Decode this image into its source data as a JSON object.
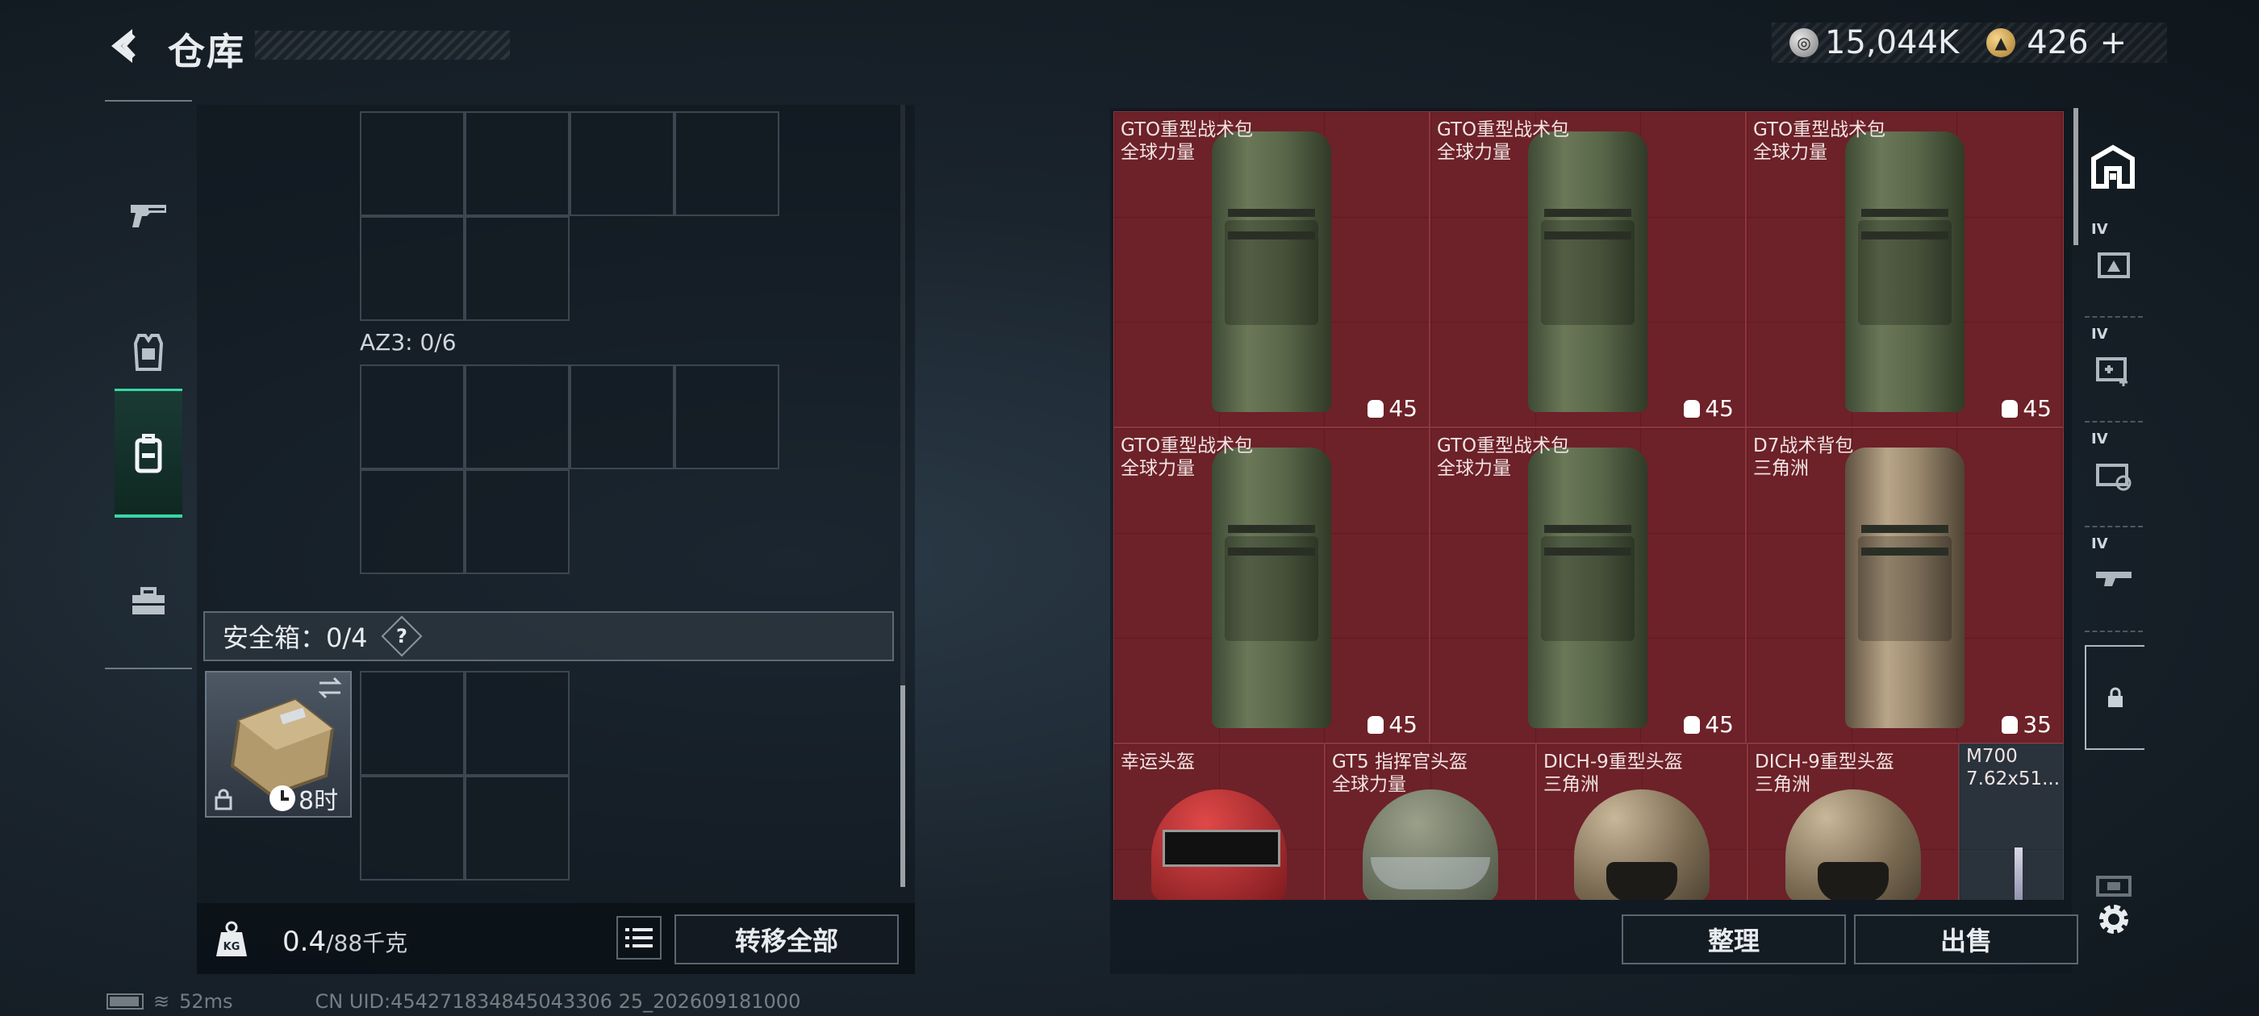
{
  "header": {
    "title": "仓库",
    "currency_silver": "15,044K",
    "currency_gold": "426",
    "currency_add": "+"
  },
  "left_tabs": [
    {
      "name": "weapons",
      "icon": "pistol-icon"
    },
    {
      "name": "equipment",
      "icon": "armor-icon"
    },
    {
      "name": "backpack",
      "icon": "backpack-icon",
      "active": true
    },
    {
      "name": "toolkit",
      "icon": "toolbox-icon"
    }
  ],
  "container": {
    "az3_label": "AZ3: 0/6",
    "safebox_label": "安全箱：0/4",
    "safebox_help": "?",
    "safebox_timer": "8时"
  },
  "weight": {
    "current": "0.4",
    "max": "/88千克"
  },
  "buttons": {
    "transfer_all": "转移全部",
    "sort": "整理",
    "sell": "出售"
  },
  "stash_items": [
    {
      "name": "GTO重型战术包",
      "sub": "全球力量",
      "cap": "45",
      "type": "bag"
    },
    {
      "name": "GTO重型战术包",
      "sub": "全球力量",
      "cap": "45",
      "type": "bag"
    },
    {
      "name": "GTO重型战术包",
      "sub": "全球力量",
      "cap": "45",
      "type": "bag"
    },
    {
      "name": "GTO重型战术包",
      "sub": "全球力量",
      "cap": "45",
      "type": "bag"
    },
    {
      "name": "GTO重型战术包",
      "sub": "全球力量",
      "cap": "45",
      "type": "bag"
    },
    {
      "name": "D7战术背包",
      "sub": "三角洲",
      "cap": "35",
      "type": "bag-tan"
    },
    {
      "name": "幸运头盔",
      "sub": "",
      "type": "helmet-red"
    },
    {
      "name": "GT5 指挥官头盔",
      "sub": "全球力量",
      "type": "helmet-olive"
    },
    {
      "name": "DICH-9重型头盔",
      "sub": "三角洲",
      "type": "helmet-camo"
    },
    {
      "name": "DICH-9重型头盔",
      "sub": "三角洲",
      "type": "helmet-camo"
    },
    {
      "name": "M700",
      "sub": "7.62x51...",
      "type": "rifle"
    }
  ],
  "stash_tabs": [
    {
      "level": "IV",
      "icon": "stash-tab-icon"
    },
    {
      "level": "IV",
      "icon": "medkit-tab-icon"
    },
    {
      "level": "IV",
      "icon": "gear-box-tab-icon"
    },
    {
      "level": "IV",
      "icon": "weapon-case-tab-icon"
    }
  ],
  "status": {
    "ping": "52ms",
    "uid": "CN UID:454271834845043306 25_202609181000"
  },
  "colors": {
    "accent": "#38d6a4",
    "item_bg": "#6d2128"
  }
}
